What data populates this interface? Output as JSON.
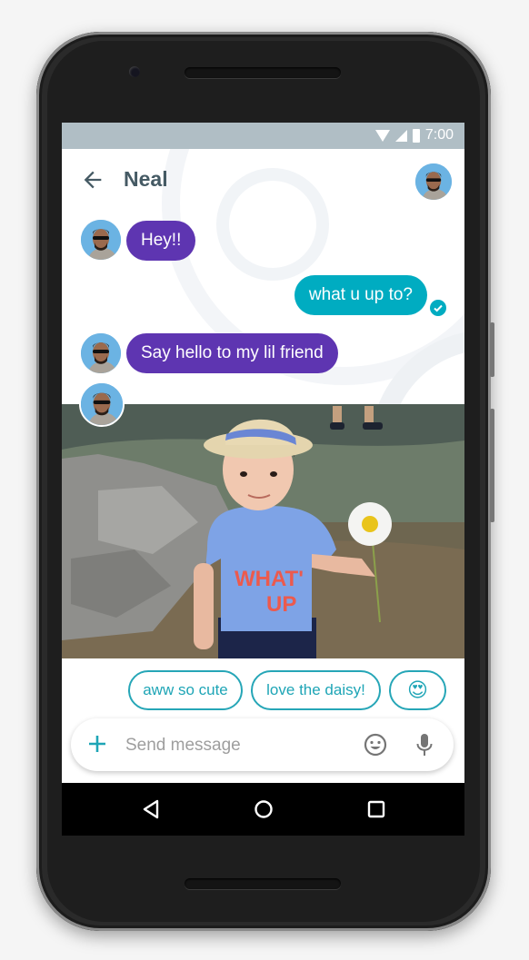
{
  "status_bar": {
    "time": "7:00",
    "icons": [
      "wifi-icon",
      "signal-icon",
      "battery-icon"
    ]
  },
  "header": {
    "title": "Neal",
    "back_icon": "arrow-left-icon",
    "contact_avatar": "avatar"
  },
  "messages": [
    {
      "direction": "incoming",
      "text": "Hey!!",
      "color": "#5e35b1"
    },
    {
      "direction": "outgoing",
      "text": "what u up to?",
      "color": "#00acc1",
      "status": "read"
    },
    {
      "direction": "incoming",
      "text": "Say hello to my lil friend",
      "color": "#5e35b1"
    },
    {
      "direction": "incoming",
      "type": "photo",
      "alt": "toddler in straw hat and blue 'WHAT'S UP' shirt holding a daisy"
    }
  ],
  "smart_replies": [
    "aww so cute",
    "love the daisy!",
    "😍"
  ],
  "composer": {
    "placeholder": "Send message",
    "value": ""
  },
  "nav": {
    "back": "back-triangle-icon",
    "home": "home-circle-icon",
    "recents": "recents-square-icon"
  },
  "colors": {
    "accent": "#00acc1",
    "incoming_bubble": "#5e35b1",
    "status_bar": "#b0bec5",
    "title": "#455a64"
  }
}
